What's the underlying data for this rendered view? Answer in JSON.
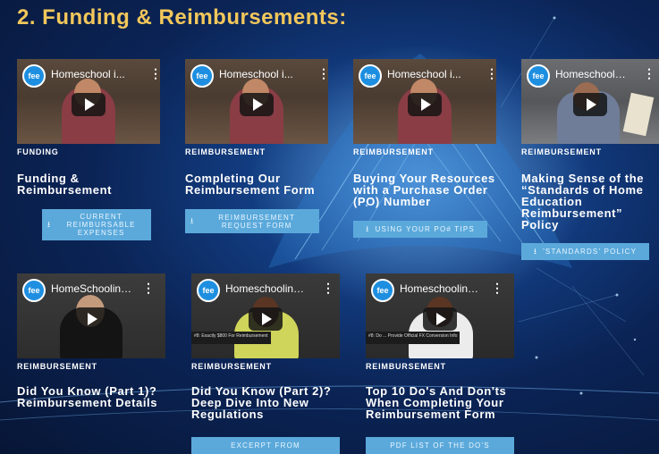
{
  "section": {
    "title": "2. Funding & Reimbursements:"
  },
  "cards": [
    {
      "video_title": "Homeschool i...",
      "logo": "fee",
      "category": "FUNDING",
      "title": "Funding & Reimbursement",
      "button": "CURRENT REIMBURSABLE EXPENSES"
    },
    {
      "video_title": "Homeschool i...",
      "logo": "fee",
      "category": "REIMBURSEMENT",
      "title": "Completing Our Reimbursement Form",
      "button": "REIMBURSEMENT REQUEST FORM"
    },
    {
      "video_title": "Homeschool i...",
      "logo": "fee",
      "category": "REIMBURSEMENT",
      "title": "Buying Your Resources with a Purchase Order (PO) Number",
      "button": "USING YOUR PO# TIPS"
    },
    {
      "video_title": "Homeschool i...",
      "logo": "fee",
      "category": "REIMBURSEMENT",
      "title": "Making Sense of the “Standards of Home Education Reimbursement” Policy",
      "button": "'STANDARDS' POLICY"
    },
    {
      "video_title": "HomeSchooling...",
      "logo": "fee",
      "category": "REIMBURSEMENT",
      "title": "Did You Know (Part 1)? Reimbursement Details",
      "button": ""
    },
    {
      "video_title": "Homeschooling ...",
      "logo": "fee",
      "category": "REIMBURSEMENT",
      "title": "Did You Know (Part 2)? Deep Dive Into New Regulations",
      "lower_third": "#8: Exactly $800 For Reimbursement",
      "button": "EXCERPT FROM"
    },
    {
      "video_title": "Homeschooling ...",
      "logo": "fee",
      "category": "REIMBURSEMENT",
      "title": "Top 10 Do's And Don'ts When Completing Your Reimbursement Form",
      "lower_third": "#8: Do ... Provide Official FX Conversion Info",
      "button": "PDF LIST OF THE DO'S"
    }
  ],
  "icons": {
    "download": "download-icon",
    "play": "play-icon",
    "menu": "kebab-menu-icon"
  },
  "colors": {
    "title": "#f2c75b",
    "button": "#5ba9db",
    "background": "#0b2456"
  }
}
